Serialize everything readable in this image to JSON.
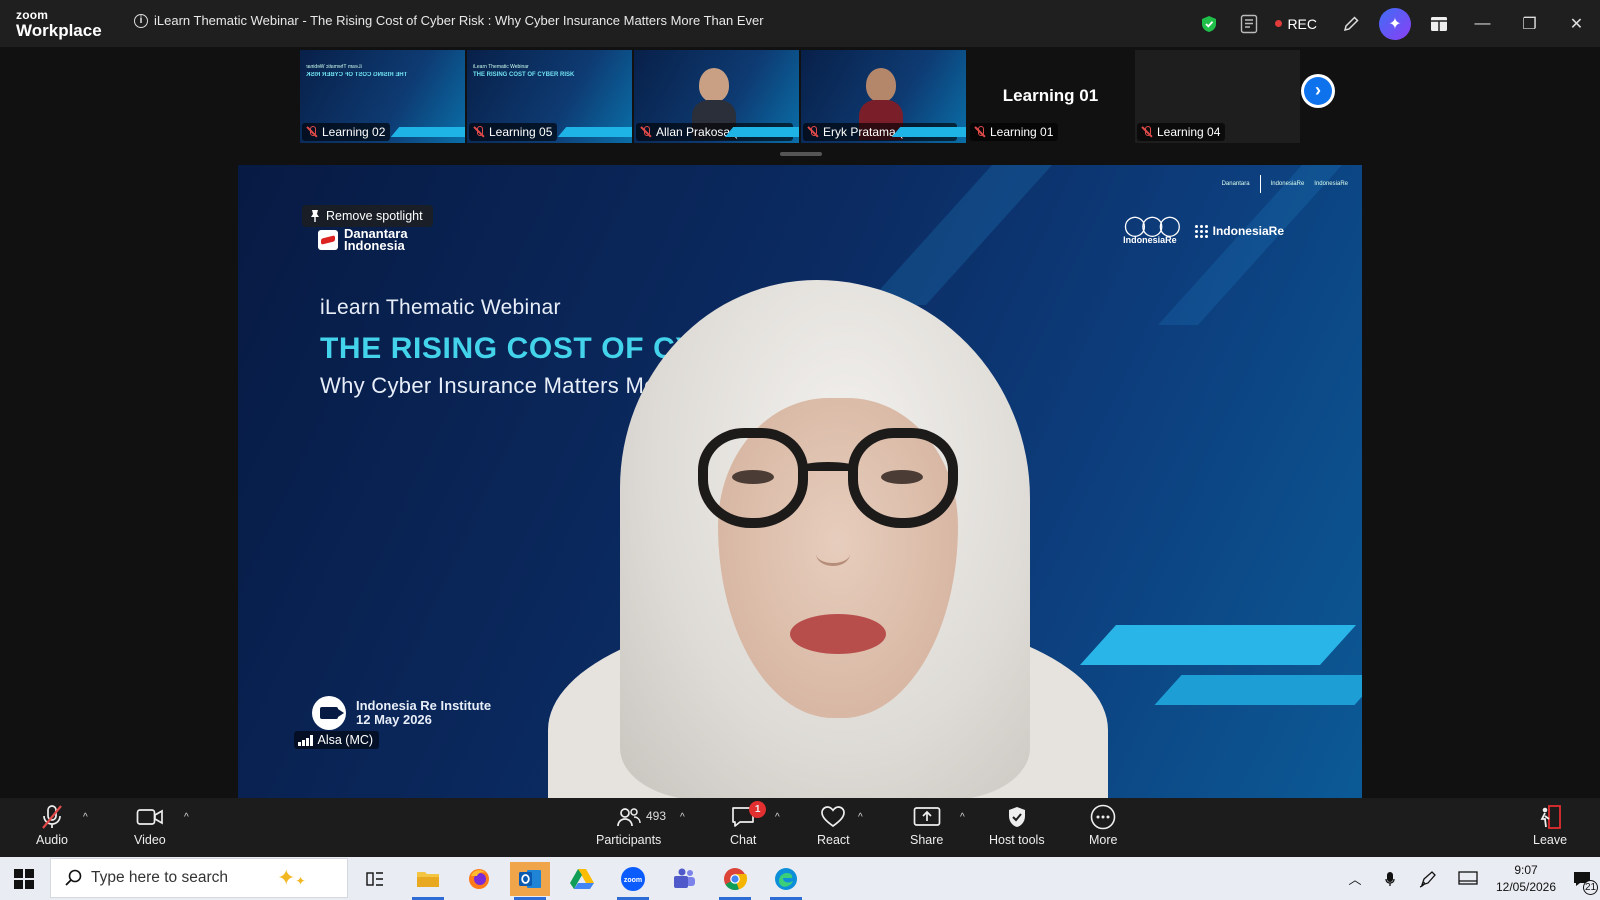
{
  "app": {
    "brand_small": "zoom",
    "brand_large": "Workplace",
    "meeting_title": "iLearn Thematic Webinar - The Rising Cost of Cyber Risk : Why Cyber Insurance Matters More Than Ever",
    "rec_label": "REC"
  },
  "gallery": {
    "tiles": [
      {
        "label": "Learning 02",
        "kind": "slide-mirror",
        "muted": true
      },
      {
        "label": "Learning 05",
        "kind": "slide",
        "muted": true
      },
      {
        "label": "Allan Prakosa (Modera...",
        "kind": "person",
        "muted": true
      },
      {
        "label": "Eryk Pratama (Narasu...",
        "kind": "person",
        "muted": true
      },
      {
        "label": "Learning 01",
        "kind": "name",
        "big_name": "Learning 01",
        "muted": true
      },
      {
        "label": "Learning 04",
        "kind": "dark",
        "muted": true
      }
    ],
    "mini_slide_subtitle": "iLearn Thematic Webinar",
    "mini_slide_title": "THE RISING COST OF CYBER RISK"
  },
  "spotlight": {
    "remove_label": "Remove spotlight",
    "speaker_name": "Alsa (MC)",
    "slide": {
      "org_logo_text_1": "Danantara",
      "org_logo_text_2": "Indonesia",
      "subtitle": "iLearn Thematic Webinar",
      "title": "THE RISING COST OF CYB",
      "tagline": "Why Cyber Insurance Matters Mo",
      "logo_ire": "IndonesiaRe",
      "logo_iri": "IndonesiaRe",
      "footer_line_1": "Indonesia Re Institute",
      "footer_line_2": "12 May 2026"
    }
  },
  "toolbar": {
    "audio": "Audio",
    "video": "Video",
    "participants": "Participants",
    "participants_count": "493",
    "chat": "Chat",
    "chat_badge": "1",
    "react": "React",
    "share": "Share",
    "host_tools": "Host tools",
    "more": "More",
    "leave": "Leave"
  },
  "taskbar": {
    "search_placeholder": "Type here to search",
    "time": "9:07",
    "date": "12/05/2026",
    "notification_count": "21"
  },
  "colors": {
    "accent_blue": "#0e72ed",
    "slide_title_cyan": "#43d3ea",
    "mute_red": "#e24a4a",
    "leave_red": "#e22f2f"
  }
}
